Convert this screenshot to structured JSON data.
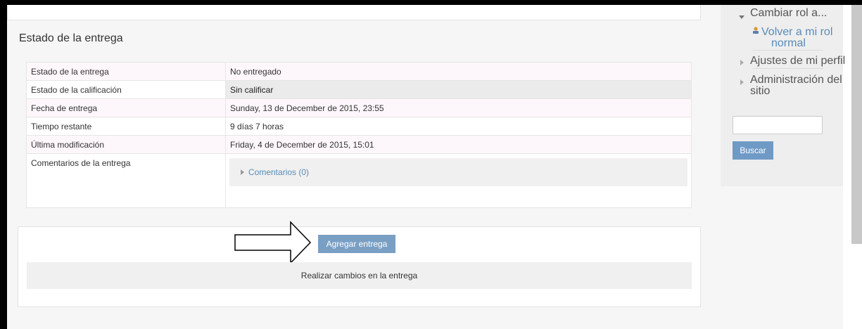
{
  "submission": {
    "title": "Estado de la entrega",
    "rows": [
      {
        "label": "Estado de la entrega",
        "value": "No entregado"
      },
      {
        "label": "Estado de la calificación",
        "value": "Sin calificar"
      },
      {
        "label": "Fecha de entrega",
        "value": "Sunday, 13 de December de 2015, 23:55"
      },
      {
        "label": "Tiempo restante",
        "value": "9 días 7 horas"
      },
      {
        "label": "Última modificación",
        "value": "Friday, 4 de December de 2015, 15:01"
      },
      {
        "label": "Comentarios de la entrega",
        "value": ""
      }
    ],
    "comments_link": "Comentarios (0)"
  },
  "actions": {
    "add_button": "Agregar entrega",
    "change_text": "Realizar cambios en la entrega"
  },
  "sidebar": {
    "switch_role": "Cambiar rol a...",
    "back_to_role": "Volver a mi rol",
    "back_to_role_2": "normal",
    "profile_settings": "Ajustes de mi perfil",
    "site_admin": "Administración del",
    "site_admin_2": "sitio",
    "search_value": "",
    "search_button": "Buscar"
  }
}
